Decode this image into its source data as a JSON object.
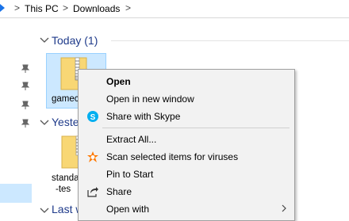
{
  "address_bar": {
    "breadcrumbs": [
      "This PC",
      "Downloads"
    ],
    "separator": ">"
  },
  "groups": [
    {
      "header": "Today (1)",
      "files": [
        {
          "name": "gamec",
          "selected": true
        }
      ]
    },
    {
      "header": "Yeste",
      "files": [
        {
          "name_line1": "standa",
          "name_line2": "-tes"
        }
      ]
    },
    {
      "header": "Last w"
    }
  ],
  "context_menu": {
    "items": [
      {
        "label": "Open",
        "bold": true
      },
      {
        "label": "Open in new window"
      },
      {
        "label": "Share with Skype",
        "icon": "skype-icon"
      },
      {
        "label": "Extract All..."
      },
      {
        "label": "Scan selected items for viruses",
        "icon": "avast-icon"
      },
      {
        "label": "Pin to Start"
      },
      {
        "label": "Share",
        "icon": "share-icon"
      },
      {
        "label": "Open with",
        "has_submenu": true
      }
    ]
  },
  "colors": {
    "accent_blue": "#1e3a8a",
    "selection": "#cce8ff",
    "menu_bg": "#f2f2f2",
    "skype": "#00aff0",
    "avast": "#ff7800",
    "folder": "#f8d775"
  }
}
